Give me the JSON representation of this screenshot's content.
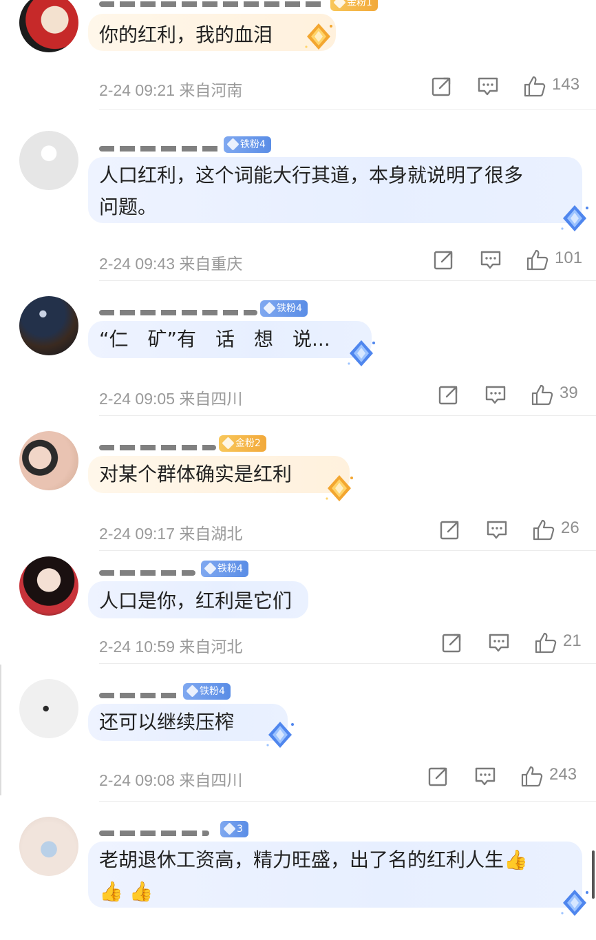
{
  "comments": [
    {
      "badge": "金粉1",
      "badge_kind": "gold",
      "text_lines": [
        "你的红利，我的血泪"
      ],
      "time": "2-24 09:21",
      "location": "来自河南",
      "likes": "143"
    },
    {
      "badge": "铁粉4",
      "badge_kind": "iron",
      "text_lines": [
        "人口红利，这个词能大行其道，本身就说明了很多",
        "问题。"
      ],
      "time": "2-24 09:43",
      "location": "来自重庆",
      "likes": "101"
    },
    {
      "badge": "铁粉4",
      "badge_kind": "iron",
      "text_lines": [
        "“仁　矿”有　话　想　说..."
      ],
      "time": "2-24 09:05",
      "location": "来自四川",
      "likes": "39"
    },
    {
      "badge": "金粉2",
      "badge_kind": "gold",
      "text_lines": [
        "对某个群体确实是红利"
      ],
      "time": "2-24 09:17",
      "location": "来自湖北",
      "likes": "26"
    },
    {
      "badge": "铁粉4",
      "badge_kind": "iron",
      "text_lines": [
        "人口是你，红利是它们"
      ],
      "time": "2-24 10:59",
      "location": "来自河北",
      "likes": "21"
    },
    {
      "badge": "铁粉4",
      "badge_kind": "iron",
      "text_lines": [
        "还可以继续压榨"
      ],
      "time": "2-24 09:08",
      "location": "来自四川",
      "likes": "243"
    },
    {
      "badge": "3",
      "badge_kind": "iron",
      "text_lines": [
        "老胡退休工资高，精力旺盛，出了名的红利人生👍",
        "👍 👍"
      ],
      "time": "",
      "location": "",
      "likes": ""
    }
  ],
  "icons": {
    "share": "share-icon",
    "comment": "comment-icon",
    "like": "thumbs-up-icon",
    "avatar": "avatar-icon",
    "fan_gem": "fan-gem-icon"
  },
  "colors": {
    "meta_text": "#9a9a9a",
    "iron_badge": "#5a8de6",
    "gold_badge": "#f2a93b",
    "bubble_blue": "#e7efff",
    "bubble_gold": "#fff1dd"
  }
}
